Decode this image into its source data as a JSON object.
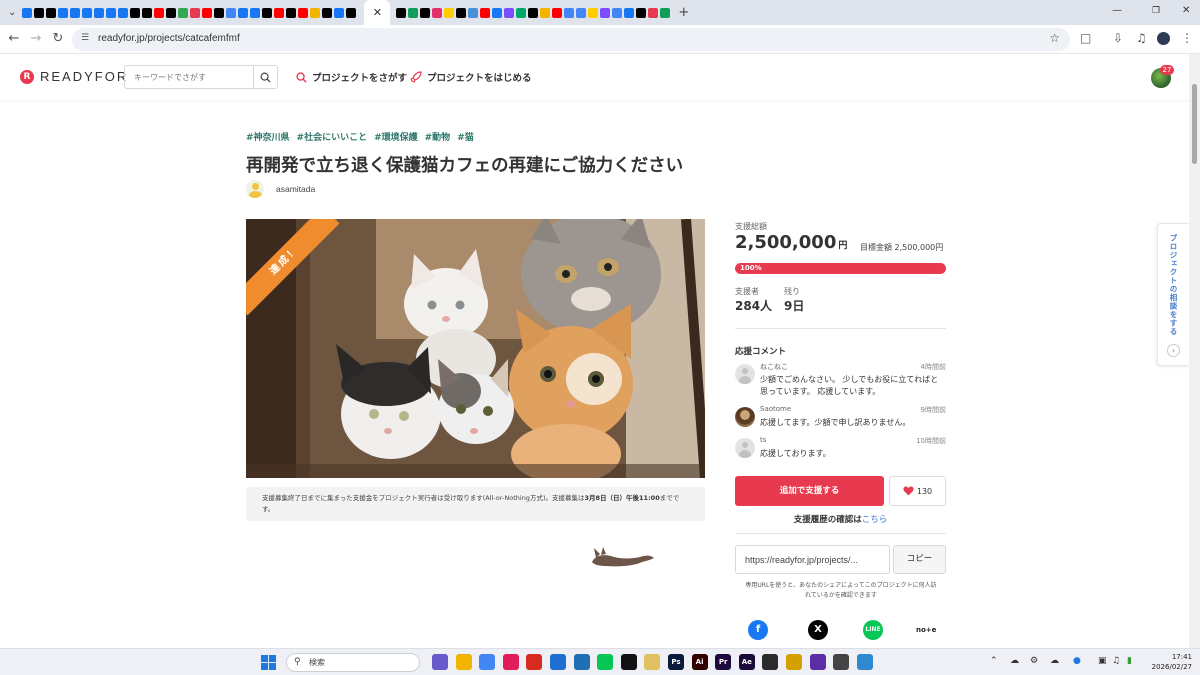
{
  "browser": {
    "url": "readyfor.jp/projects/catcafemfmf",
    "tab_colors": [
      "#1877f2",
      "#000",
      "#000",
      "#1877f2",
      "#1877f2",
      "#1877f2",
      "#1877f2",
      "#1877f2",
      "#1877f2",
      "#000",
      "#000",
      "#ff0000",
      "#000",
      "#34a853",
      "#e83a4f",
      "#ff0000",
      "#000",
      "#4285f4",
      "#000",
      "#0f9d58",
      "#000",
      "#e1306c",
      "#ffcc00",
      "#000",
      "#4a90d9",
      "#ff0000",
      "#1877f2",
      "#7c4dff",
      "#00a86b",
      "#000",
      "#f4b400",
      "#ff0000",
      "#4285f4"
    ]
  },
  "header": {
    "logo_text": "READYFOR",
    "search_placeholder": "キーワードでさがす",
    "nav_find": "プロジェクトをさがす",
    "nav_start": "プロジェクトをはじめる",
    "notification_count": "27"
  },
  "project": {
    "tags": [
      "#神奈川県",
      "#社会にいいこと",
      "#環境保護",
      "#動物",
      "#猫"
    ],
    "title": "再開発で立ち退く保護猫カフェの再建にご協力ください",
    "owner": "asamitada",
    "ribbon": "達成！",
    "notice_pre": "支援募集終了日までに集まった支援金をプロジェクト実行者は受け取ります(All-or-Nothing方式)。支援募集は",
    "notice_bold": "3月8日（日）午後11:00",
    "notice_post": "までです。"
  },
  "sidebar": {
    "label_total": "支援総額",
    "amount": "2,500,000",
    "amount_unit": "円",
    "goal": "目標金額 2,500,000円",
    "progress_fraction": 1.0,
    "progress_label": "100%",
    "supporters_label": "支援者",
    "supporters_value": "284人",
    "remaining_label": "残り",
    "remaining_value": "9日",
    "comments_heading": "応援コメント",
    "comments": [
      {
        "user": "ねこねこ",
        "time": "4時間前",
        "text": "少額でごめんなさい。 少しでもお役に立てればと思っています。 応援しています。"
      },
      {
        "user": "Saotome",
        "time": "9時間前",
        "text": "応援してます。少額で申し訳ありません。"
      },
      {
        "user": "ts",
        "time": "10時間前",
        "text": "応援しております。"
      }
    ],
    "support_button": "追加で支援する",
    "like_count": "130",
    "history_text": "支援履歴の確認は",
    "history_link": "こちら",
    "share_url": "https://readyfor.jp/projects/...",
    "copy_button": "コピー",
    "share_note": "専用URLを使うと、あなたのシェアによってこのプロジェクトに何人訪れているかを確認できます",
    "note_label": "no+e",
    "consult_tab": "プロジェクトの相談をする"
  },
  "colors": {
    "brand_red": "#e83a4f",
    "tag_green": "#2f7a6b",
    "ribbon_orange": "#f08c2e",
    "link_blue": "#3a7bd5"
  },
  "taskbar": {
    "search_label": "検索",
    "time": "17:41",
    "date": "2026/02/27",
    "apps": [
      {
        "label": "",
        "color": "#6a5acd"
      },
      {
        "label": "",
        "color": "#f2b400"
      },
      {
        "label": "",
        "color": "#4285f4"
      },
      {
        "label": "",
        "color": "#e01e5a"
      },
      {
        "label": "",
        "color": "#d62d20"
      },
      {
        "label": "",
        "color": "#1e6fd0"
      },
      {
        "label": "",
        "color": "#1f6fb2"
      },
      {
        "label": "",
        "color": "#06c755"
      },
      {
        "label": "",
        "color": "#111"
      },
      {
        "label": "",
        "color": "#e0c060"
      },
      {
        "label": "Ps",
        "color": "#0a1a3a"
      },
      {
        "label": "Ai",
        "color": "#330000"
      },
      {
        "label": "Pr",
        "color": "#1e0a3c"
      },
      {
        "label": "Ae",
        "color": "#1a0a3a"
      },
      {
        "label": "",
        "color": "#2b2b2b"
      },
      {
        "label": "",
        "color": "#d4a000"
      },
      {
        "label": "",
        "color": "#5b2ea6"
      },
      {
        "label": "",
        "color": "#444"
      },
      {
        "label": "",
        "color": "#2f88d0"
      }
    ]
  }
}
